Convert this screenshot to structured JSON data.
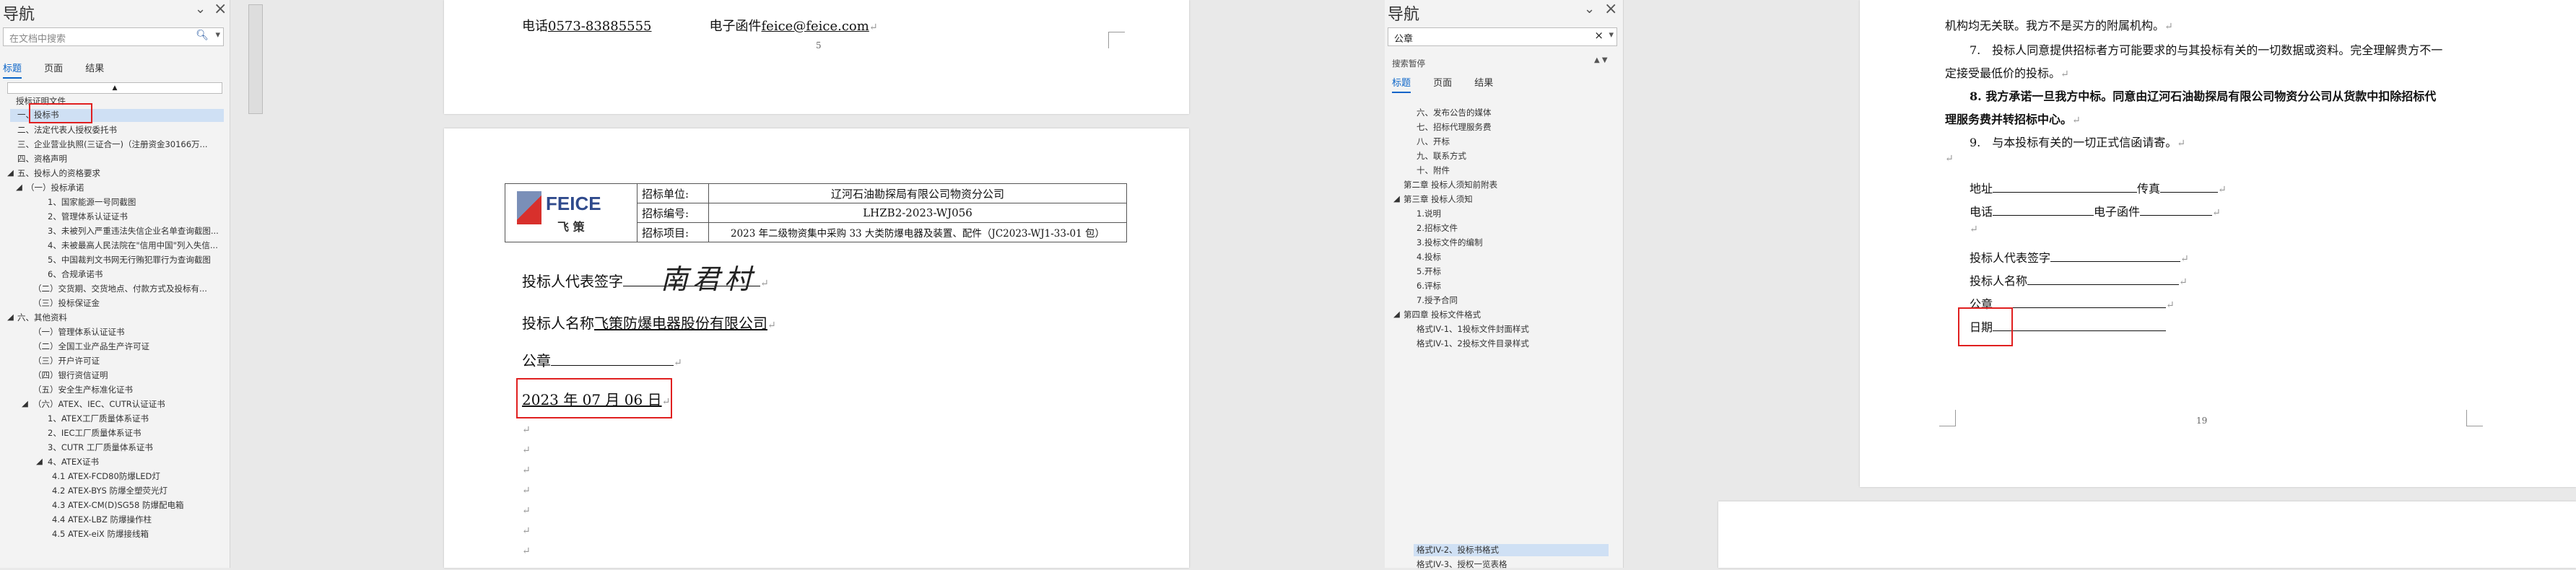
{
  "left_nav": {
    "title": "导航",
    "search_placeholder": "在文档中搜索",
    "tabs": [
      "标题",
      "页面",
      "结果"
    ],
    "items": [
      "授标证明文件",
      "一、投标书",
      "二、法定代表人授权委托书",
      "三、企业营业执照(三证合一)（注册资金30166万...",
      "四、资格声明",
      "五、投标人的资格要求",
      "（一）投标承诺",
      "1、国家能源一号同截图",
      "2、管理体系认证证书",
      "3、未被列入严重违法失信企业名单查询截图...",
      "4、未被最高人民法院在\"信用中国\"列入失信...",
      "5、中国裁判文书网无行贿犯罪行为查询截图",
      "6、合规承诺书",
      "（二）交货期、交货地点、付款方式及投标有...",
      "（三）投标保证金",
      "六、其他资料",
      "（一）管理体系认证证书",
      "（二）全国工业产品生产许可证",
      "（三）开户许可证",
      "（四）银行资信证明",
      "（五）安全生产标准化证书",
      "（六）ATEX、IEC、CUTR认证证书",
      "1、ATEX工厂质量体系证书",
      "2、IEC工厂质量体系证书",
      "3、CUTR 工厂质量体系证书",
      "4、ATEX证书",
      "4.1 ATEX-FCD80防爆LED灯",
      "4.2 ATEX-BYS 防爆全塑荧光灯",
      "4.3 ATEX-CM(D)SG58 防爆配电箱",
      "4.4 ATEX-LBZ 防爆操作柱",
      "4.5 ATEX-eiX 防爆接线箱"
    ]
  },
  "doc1": {
    "top_page": {
      "phone_label": "电话",
      "phone_value": "0573-83885555",
      "email_label": "电子函件",
      "email_value": "feice@feice.com",
      "page_number": "5"
    },
    "table": {
      "logo_text": "FEICE",
      "logo_sub": "飞 策",
      "rows": [
        {
          "label": "招标单位:",
          "value": "辽河石油勘探局有限公司物资分公司"
        },
        {
          "label": "招标编号:",
          "value": "LHZB2-2023-WJ056"
        },
        {
          "label": "招标项目:",
          "value": "2023 年二级物资集中采购 33 大类防爆电器及装置、配件（JC2023-WJ1-33-01 包）"
        }
      ]
    },
    "rep_label": "投标人代表签字",
    "signature": "南君村",
    "bidder_label": "投标人名称",
    "bidder_value": "飞策防爆电器股份有限公司",
    "seal_label": "公章",
    "date_value": "2023 年 07 月 06 日"
  },
  "right_nav": {
    "title": "导航",
    "search_value": "公章",
    "result_text": "搜索暂停",
    "tabs": [
      "标题",
      "页面",
      "结果"
    ],
    "items": [
      "六、发布公告的媒体",
      "七、招标代理服务费",
      "八、开标",
      "九、联系方式",
      "十、附件",
      "第二章 投标人须知前附表",
      "第三章 投标人须知",
      "1.说明",
      "2.招标文件",
      "3.投标文件的编制",
      "4.投标",
      "5.开标",
      "6.评标",
      "7.授予合同",
      "第四章 投标文件格式",
      "格式IV-1、1投标文件封面样式",
      "格式IV-1、2投标文件目录样式"
    ],
    "bottom_items": [
      "格式IV-2、投标书格式",
      "格式IV-3、授权一览表格"
    ]
  },
  "doc2": {
    "line1": "机构均无关联。我方不是买方的附属机构。",
    "item7": "7.　投标人同意提供招标者方可能要求的与其投标有关的一切数据或资料。完全理解贵方不一",
    "item7b": "定接受最低价的投标。",
    "item8": "8. 我方承诺一旦我方中标。同意由辽河石油勘探局有限公司物资分公司从货款中扣除招标代",
    "item8b": "理服务费并转招标中心。",
    "item9": "9.　与本投标有关的一切正式信函请寄。",
    "address_label": "地址",
    "fax_label": "传真",
    "phone_label": "电话",
    "email_label": "电子函件",
    "rep_label": "投标人代表签字",
    "bidder_label": "投标人名称",
    "seal_label": "公章",
    "date_label": "日期",
    "page_number": "19"
  }
}
